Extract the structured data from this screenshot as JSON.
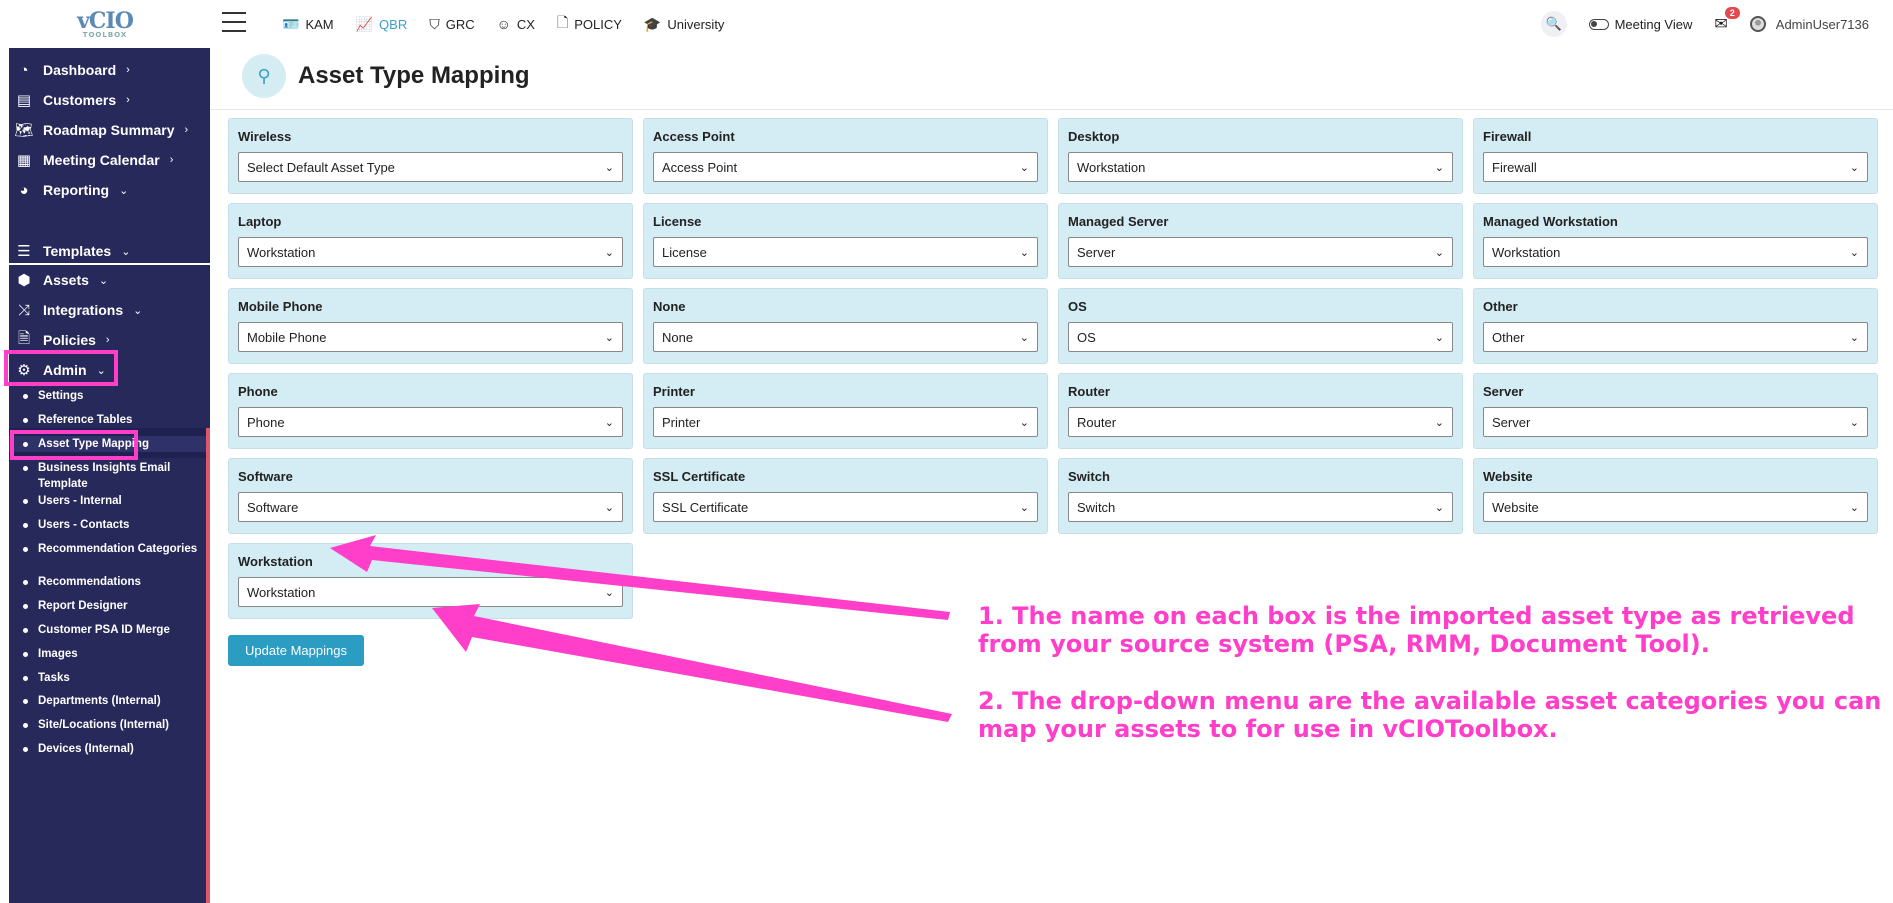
{
  "logo": {
    "text": "vCIO",
    "sub": "TOOLBOX"
  },
  "topnav": [
    {
      "label": "KAM",
      "icon": "id-card-icon",
      "glyph": "🪪",
      "active": false
    },
    {
      "label": "QBR",
      "icon": "chart-line-icon",
      "glyph": "📈",
      "active": true
    },
    {
      "label": "GRC",
      "icon": "shield-icon",
      "glyph": "⛉",
      "active": false
    },
    {
      "label": "CX",
      "icon": "smile-icon",
      "glyph": "☺",
      "active": false
    },
    {
      "label": "POLICY",
      "icon": "document-icon",
      "glyph": "🗋",
      "active": false
    },
    {
      "label": "University",
      "icon": "graduation-cap-icon",
      "glyph": "🎓",
      "active": false
    }
  ],
  "topright": {
    "meeting_view": "Meeting View",
    "mail_count": "2",
    "user": "AdminUser7136"
  },
  "sidebar": {
    "items": [
      {
        "label": "Dashboard",
        "icon": "gauge-icon",
        "glyph": "◔",
        "chev": "›"
      },
      {
        "label": "Customers",
        "icon": "contact-card-icon",
        "glyph": "▤",
        "chev": "›"
      },
      {
        "label": "Roadmap Summary",
        "icon": "map-icon",
        "glyph": "🗺",
        "chev": "›"
      },
      {
        "label": "Meeting Calendar",
        "icon": "calendar-icon",
        "glyph": "▦",
        "chev": "›"
      },
      {
        "label": "Reporting",
        "icon": "pie-chart-icon",
        "glyph": "◕",
        "chev": "⌄"
      },
      {
        "label": "Templates",
        "icon": "list-icon",
        "glyph": "☰",
        "chev": "⌄"
      },
      {
        "label": "Assets",
        "icon": "boxes-icon",
        "glyph": "⬢",
        "chev": "⌄"
      },
      {
        "label": "Integrations",
        "icon": "shuffle-icon",
        "glyph": "⤨",
        "chev": "⌄"
      },
      {
        "label": "Policies",
        "icon": "policy-icon",
        "glyph": "🗎",
        "chev": "›"
      },
      {
        "label": "Admin",
        "icon": "users-gear-icon",
        "glyph": "⚙",
        "chev": "⌄"
      }
    ],
    "admin_sub": [
      "Settings",
      "Reference Tables",
      "Asset Type Mapping",
      "Business Insights Email Template",
      "Users - Internal",
      "Users - Contacts",
      "Recommendation Categories",
      "Recommendations",
      "Report Designer",
      "Customer PSA ID Merge",
      "Images",
      "Tasks",
      "Departments (Internal)",
      "Site/Locations (Internal)",
      "Devices (Internal)"
    ]
  },
  "page": {
    "title": "Asset Type Mapping",
    "icon": "mapping-icon"
  },
  "mappings": [
    {
      "label": "Wireless",
      "value": "Select Default Asset Type"
    },
    {
      "label": "Access Point",
      "value": "Access Point"
    },
    {
      "label": "Desktop",
      "value": "Workstation"
    },
    {
      "label": "Firewall",
      "value": "Firewall"
    },
    {
      "label": "Laptop",
      "value": "Workstation"
    },
    {
      "label": "License",
      "value": "License"
    },
    {
      "label": "Managed Server",
      "value": "Server"
    },
    {
      "label": "Managed Workstation",
      "value": "Workstation"
    },
    {
      "label": "Mobile Phone",
      "value": "Mobile Phone"
    },
    {
      "label": "None",
      "value": "None"
    },
    {
      "label": "OS",
      "value": "OS"
    },
    {
      "label": "Other",
      "value": "Other"
    },
    {
      "label": "Phone",
      "value": "Phone"
    },
    {
      "label": "Printer",
      "value": "Printer"
    },
    {
      "label": "Router",
      "value": "Router"
    },
    {
      "label": "Server",
      "value": "Server"
    },
    {
      "label": "Software",
      "value": "Software"
    },
    {
      "label": "SSL Certificate",
      "value": "SSL Certificate"
    },
    {
      "label": "Switch",
      "value": "Switch"
    },
    {
      "label": "Website",
      "value": "Website"
    },
    {
      "label": "Workstation",
      "value": "Workstation"
    }
  ],
  "update_button": "Update Mappings",
  "annotations": {
    "note1": "1. The name on each box is the imported asset type as retrieved from your source system (PSA, RMM, Document Tool).",
    "note2": "2. The drop-down menu are the available asset categories you can map your assets to for use in vCIOToolbox."
  },
  "colors": {
    "accent": "#2b9cc2",
    "sidebar": "#26295a",
    "highlight": "#ff3ec9",
    "card": "#d4ecf3"
  }
}
